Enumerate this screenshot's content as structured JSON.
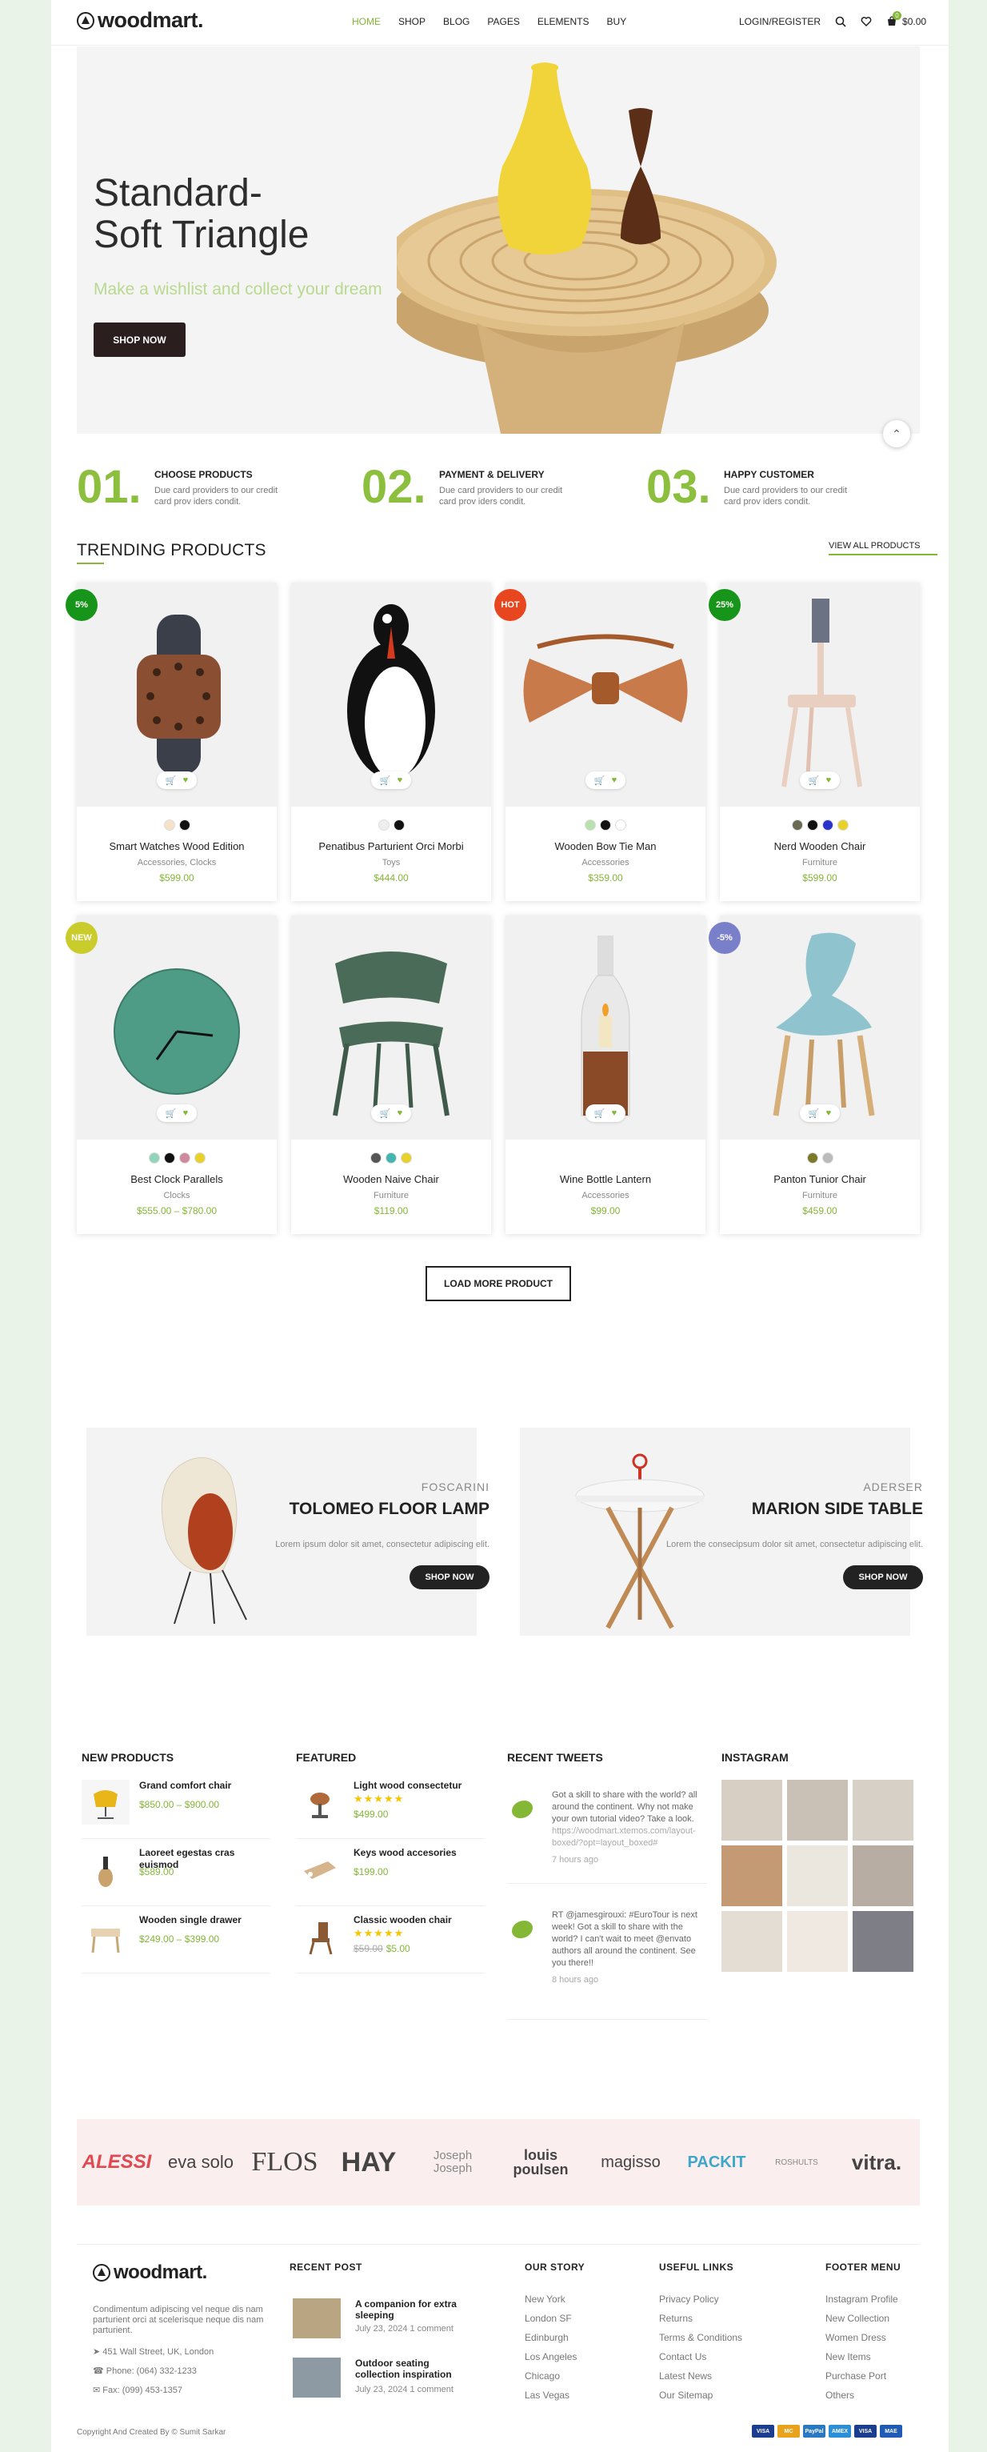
{
  "header": {
    "logo": "woodmart.",
    "nav": [
      "HOME",
      "SHOP",
      "BLOG",
      "PAGES",
      "ELEMENTS",
      "BUY"
    ],
    "login": "LOGIN/REGISTER",
    "cart_count": "0",
    "cart_total": "$0.00"
  },
  "hero": {
    "title_line1": "Standard-",
    "title_line2": "Soft Triangle",
    "subtitle": "Make a wishlist and collect your dream",
    "button": "SHOP NOW"
  },
  "steps": [
    {
      "num": "01.",
      "title": "CHOOSE PRODUCTS",
      "desc": "Due card providers to our credit card prov iders condit."
    },
    {
      "num": "02.",
      "title": "PAYMENT & DELIVERY",
      "desc": "Due card providers to our credit card prov iders condit."
    },
    {
      "num": "03.",
      "title": "HAPPY CUSTOMER",
      "desc": "Due card providers to our credit card prov iders condit."
    }
  ],
  "trending": {
    "title": "TRENDING PRODUCTS",
    "view_all": "VIEW ALL PRODUCTS",
    "load_more": "LOAD MORE PRODUCT",
    "products": [
      {
        "name": "Smart Watches Wood Edition",
        "category": "Accessories, Clocks",
        "price": "$599.00",
        "tag": "5%",
        "tag_color": "#17951a",
        "swatches": [
          "#f4e3c8",
          "#111111"
        ]
      },
      {
        "name": "Penatibus Parturient Orci Morbi",
        "category": "Toys",
        "price": "$444.00",
        "tag": "",
        "tag_color": "",
        "swatches": [
          "#eeeeee",
          "#111111"
        ]
      },
      {
        "name": "Wooden Bow Tie Man",
        "category": "Accessories",
        "price": "$359.00",
        "tag": "HOT",
        "tag_color": "#e8461e",
        "swatches": [
          "#b8e0b0",
          "#111111",
          "#ffffff"
        ]
      },
      {
        "name": "Nerd Wooden Chair",
        "category": "Furniture",
        "price": "$599.00",
        "tag": "25%",
        "tag_color": "#17951a",
        "swatches": [
          "#6b6b55",
          "#111111",
          "#2a33cc",
          "#e8d22a"
        ]
      },
      {
        "name": "Best Clock Parallels",
        "category": "Clocks",
        "price": "$555.00 – $780.00",
        "tag": "NEW",
        "tag_color": "#c9cc2a",
        "swatches": [
          "#8fd6b8",
          "#111111",
          "#d08aa0",
          "#e8d22a"
        ]
      },
      {
        "name": "Wooden Naive Chair",
        "category": "Furniture",
        "price": "$119.00",
        "tag": "",
        "tag_color": "",
        "swatches": [
          "#555555",
          "#44b6b0",
          "#e8d22a"
        ]
      },
      {
        "name": "Wine Bottle Lantern",
        "category": "Accessories",
        "price": "$99.00",
        "tag": "",
        "tag_color": "",
        "swatches": []
      },
      {
        "name": "Panton Tunior Chair",
        "category": "Furniture",
        "price": "$459.00",
        "tag": "-5%",
        "tag_color": "#7a7fc9",
        "swatches": [
          "#7a7a2a",
          "#bbbbbb"
        ]
      }
    ]
  },
  "promos": [
    {
      "brand": "FOSCARINI",
      "title": "TOLOMEO FLOOR LAMP",
      "desc": "Lorem ipsum dolor sit amet, consectetur adipiscing elit.",
      "button": "SHOP NOW"
    },
    {
      "brand": "ADERSER",
      "title": "MARION SIDE TABLE",
      "desc": "Lorem the consecipsum dolor sit amet, consectetur adipiscing elit.",
      "button": "SHOP NOW"
    }
  ],
  "widgets": {
    "new_products": {
      "title": "NEW PRODUCTS",
      "items": [
        {
          "name": "Grand comfort chair",
          "price": "$850.00 – $900.00"
        },
        {
          "name": "Laoreet egestas cras euismod",
          "price": "$589.00"
        },
        {
          "name": "Wooden single drawer",
          "price": "$249.00 – $399.00"
        }
      ]
    },
    "featured": {
      "title": "FEATURED",
      "items": [
        {
          "name": "Light wood consectetur",
          "price": "$499.00",
          "old": "",
          "stars": "★★★★★"
        },
        {
          "name": "Keys wood accesories",
          "price": "$199.00",
          "old": "",
          "stars": ""
        },
        {
          "name": "Classic wooden chair",
          "price": "$5.00",
          "old": "$59.00",
          "stars": "★★★★★"
        }
      ]
    },
    "tweets": {
      "title": "RECENT TWEETS",
      "items": [
        {
          "text": "Got a skill to share with the world? all around the continent. Why not make your own tutorial video? Take a look.",
          "link": "https://woodmart.xtemos.com/layout-boxed/?opt=layout_boxed#",
          "time": "7 hours ago"
        },
        {
          "text": "RT @jamesgirouxi: #EuroTour is next week! Got a skill to share with the world? I can't wait to meet @envato authors all around the continent. See you there!!",
          "link": "",
          "time": "8 hours ago"
        }
      ]
    },
    "instagram": {
      "title": "INSTAGRAM"
    }
  },
  "brands": [
    "ALESSI",
    "eva solo",
    "FLOS",
    "HAY",
    "Joseph Joseph",
    "louis poulsen",
    "magisso",
    "PACKIT",
    "ROSHULTS",
    "vitra."
  ],
  "footer": {
    "logo": "woodmart.",
    "about": "Condimentum adipiscing vel neque dis nam parturient orci at scelerisque neque dis nam parturient.",
    "address": "451 Wall Street, UK, London",
    "phone": "Phone: (064) 332-1233",
    "fax": "Fax: (099) 453-1357",
    "recent_post_title": "RECENT POST",
    "posts": [
      {
        "title": "A companion for extra sleeping",
        "meta": "July 23, 2024 1 comment"
      },
      {
        "title": "Outdoor seating collection inspiration",
        "meta": "July 23, 2024 1 comment"
      }
    ],
    "our_story": {
      "title": "OUR STORY",
      "links": [
        "New York",
        "London SF",
        "Edinburgh",
        "Los Angeles",
        "Chicago",
        "Las Vegas"
      ]
    },
    "useful": {
      "title": "USEFUL LINKS",
      "links": [
        "Privacy Policy",
        "Returns",
        "Terms & Conditions",
        "Contact Us",
        "Latest News",
        "Our Sitemap"
      ]
    },
    "menu": {
      "title": "FOOTER MENU",
      "links": [
        "Instagram Profile",
        "New Collection",
        "Women Dress",
        "New Items",
        "Purchase Port",
        "Others"
      ]
    },
    "copyright": "Copyright And Created By © Sumit Sarkar",
    "payments": [
      "VISA",
      "MC",
      "PayPal",
      "AMEX",
      "VISA",
      "MAE"
    ]
  },
  "colors": {
    "accent": "#83b735",
    "dark_button": "#2a1e1e",
    "brand_band": "#faeeee",
    "page_bg": "#eaf3e7"
  }
}
